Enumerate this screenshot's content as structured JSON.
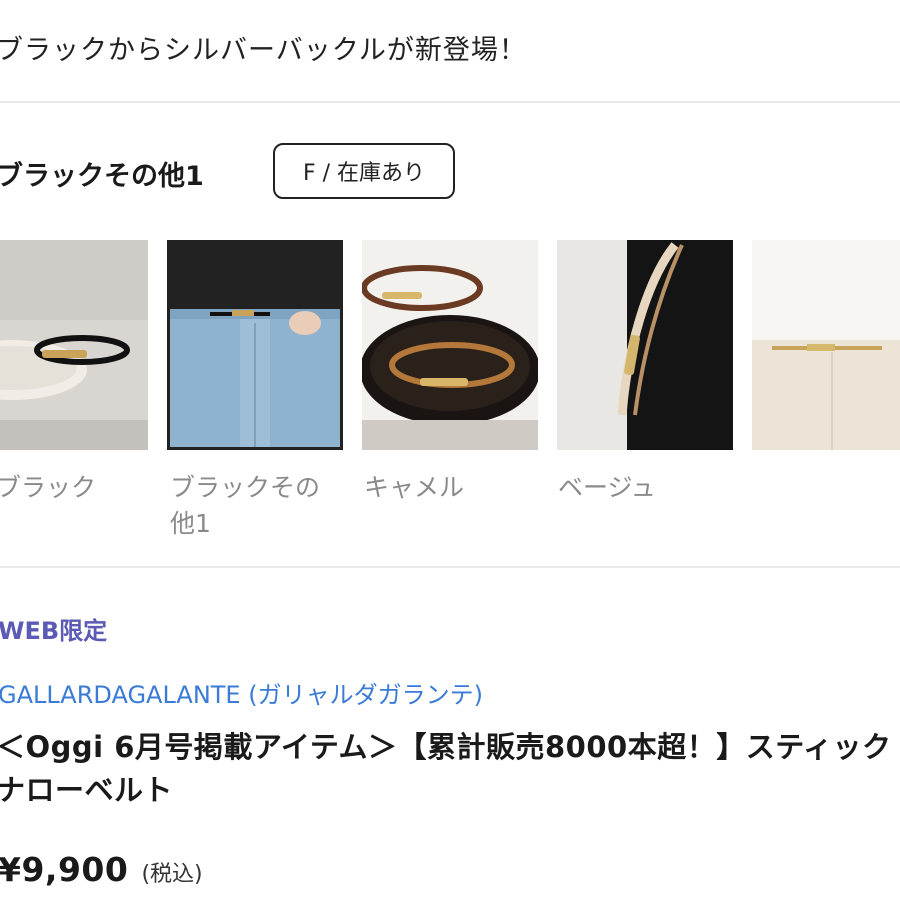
{
  "headline": "ブラックからシルバーバックルが新登場！",
  "selection": {
    "color_name": "ブラックその他1",
    "stock": "F / 在庫あり"
  },
  "swatches": [
    {
      "label": "ブラック",
      "icon": "black-belt-photo"
    },
    {
      "label": "ブラックその他1",
      "icon": "black-other-belt-worn-photo"
    },
    {
      "label": "キャメル",
      "icon": "camel-belt-tray-photo"
    },
    {
      "label": "ベージュ",
      "icon": "beige-belt-photo"
    },
    {
      "label": "",
      "icon": "ivory-belt-worn-photo"
    }
  ],
  "product": {
    "badge": "WEB限定",
    "brand": "GALLARDAGALANTE (ガリャルダガランテ)",
    "title": "＜Oggi 6月号掲載アイテム＞【累計販売8000本超！】スティックナローベルト",
    "price": "¥9,900",
    "tax_note": "(税込)"
  },
  "colors": {
    "badge": "#5b5bb5",
    "brand_link": "#3a7bd5",
    "divider": "#e8e8e8",
    "swatch_label": "#8a8a8a"
  }
}
